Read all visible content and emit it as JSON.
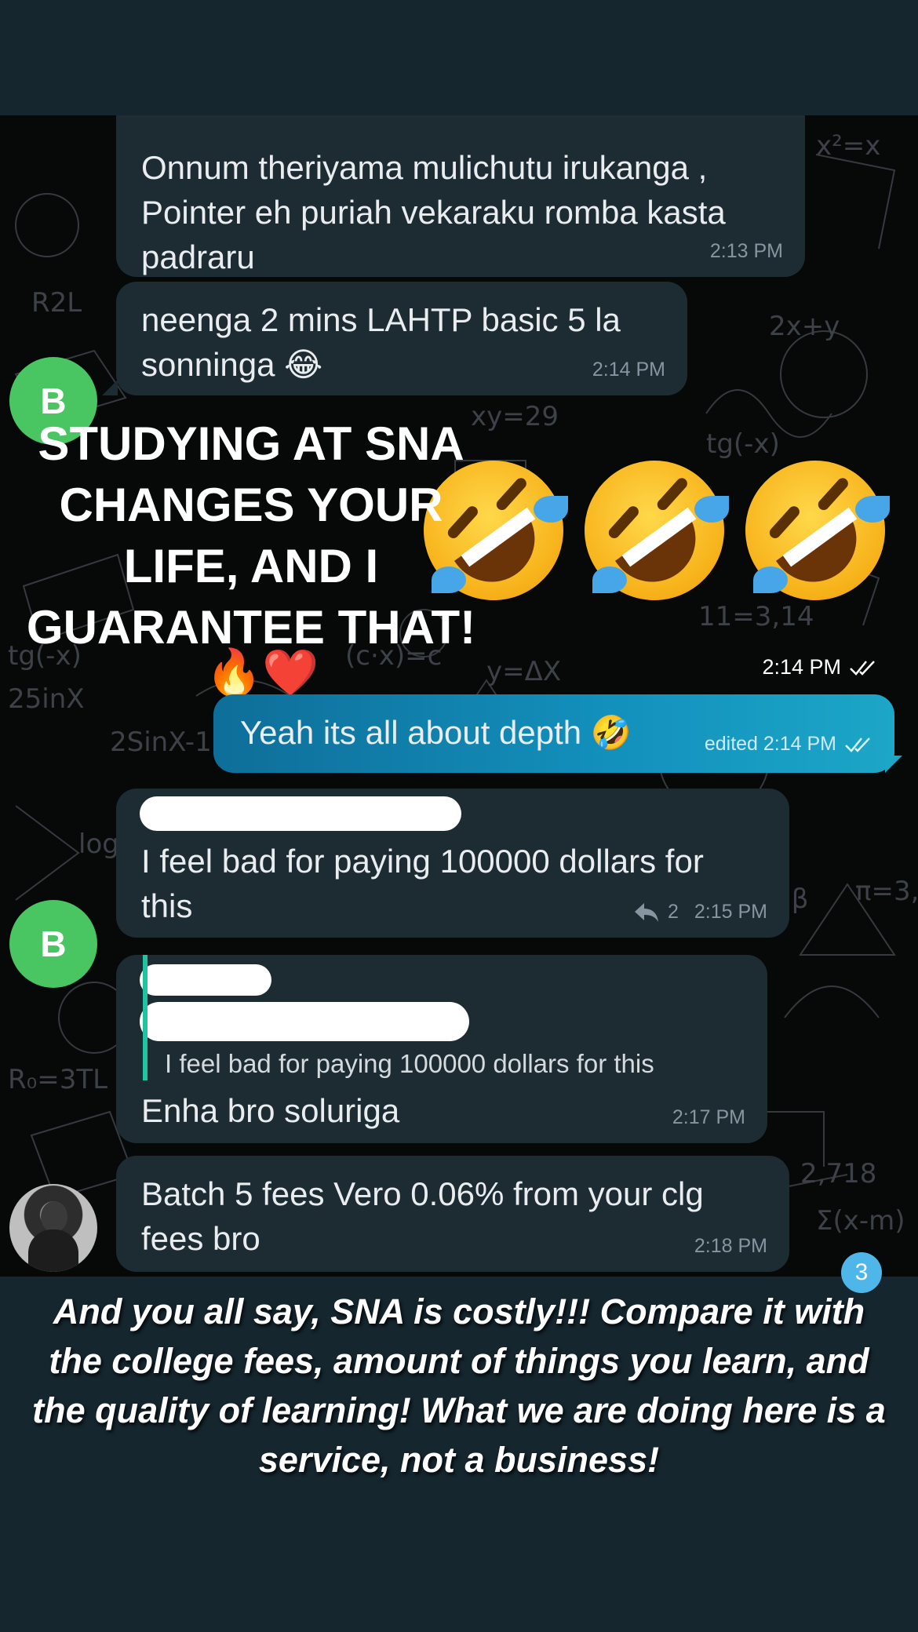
{
  "messages": [
    {
      "text": "Onnum theriyama mulichutu irukanga ,\nPointer eh puriah vekaraku romba kasta\npadraru",
      "time": "2:13 PM"
    },
    {
      "text": "neenga 2 mins LAHTP basic 5 la\nsonninga 😂",
      "time": "2:14 PM",
      "avatar": "B"
    },
    {
      "text": "🤣🤣🤣",
      "time": "2:14 PM",
      "emoji_count": 3
    },
    {
      "text": "Yeah its all about depth 🤣",
      "time": "edited 2:14 PM",
      "direction": "outgoing"
    },
    {
      "text": "I feel bad for paying 100000 dollars for\nthis",
      "time": "2:15 PM",
      "reply_count": "2",
      "avatar": "B"
    },
    {
      "quote": "I feel bad for paying 100000 dollars for this",
      "text": "Enha bro soluriga",
      "time": "2:17 PM"
    },
    {
      "text": "Batch 5 fees Vero 0.06% from your clg\nfees bro",
      "time": "2:18 PM"
    }
  ],
  "overlay": {
    "title": "STUDYING AT SNA\nCHANGES YOUR\nLIFE, AND I\nGUARANTEE THAT!",
    "title_emojis": "🔥❤️"
  },
  "unread_badge": "3",
  "caption": "And you all say, SNA is costly!!! Compare it with the college fees, amount of things you learn, and the quality of learning! What we are doing here is a service, not a business!",
  "colors": {
    "background": "#15262f",
    "chat_background": "#070808",
    "incoming_bubble": "#1d2b33",
    "outgoing_bubble": "#1391bd",
    "avatar": "#49c562",
    "timestamp": "#8696a0",
    "quote_bar": "#21c4a0",
    "badge": "#4fb6ea"
  },
  "icons": [
    "reply-icon",
    "double-check-icon",
    "fire-emoji",
    "heart-emoji",
    "rofl-emoji",
    "joy-emoji"
  ]
}
